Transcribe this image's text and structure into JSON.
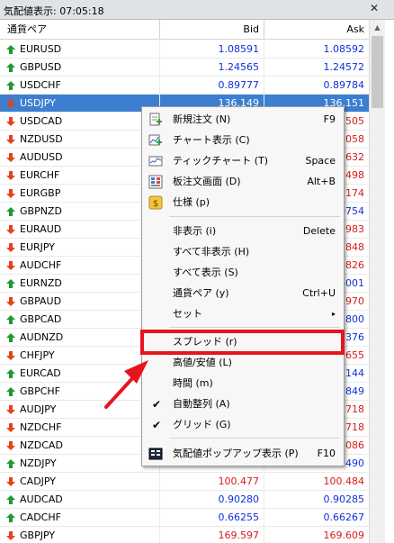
{
  "window": {
    "title": "気配値表示: 07:05:18",
    "close_glyph": "✕"
  },
  "columns": {
    "symbol": "通貨ペア",
    "bid": "Bid",
    "ask": "Ask"
  },
  "rows": [
    {
      "symbol": "EURUSD",
      "bid": "1.08591",
      "ask": "1.08592",
      "dir": "up"
    },
    {
      "symbol": "GBPUSD",
      "bid": "1.24565",
      "ask": "1.24572",
      "dir": "up"
    },
    {
      "symbol": "USDCHF",
      "bid": "0.89777",
      "ask": "0.89784",
      "dir": "up"
    },
    {
      "symbol": "USDJPY",
      "bid": "136.149",
      "ask": "136.151",
      "dir": "down",
      "selected": true
    },
    {
      "symbol": "USDCAD",
      "bid": "",
      "ask": "505",
      "dir": "down"
    },
    {
      "symbol": "NZDUSD",
      "bid": "",
      "ask": "2058",
      "dir": "down"
    },
    {
      "symbol": "AUDUSD",
      "bid": "",
      "ask": "5632",
      "dir": "down"
    },
    {
      "symbol": "EURCHF",
      "bid": "",
      "ask": "7498",
      "dir": "down"
    },
    {
      "symbol": "EURGBP",
      "bid": "",
      "ask": "7174",
      "dir": "down"
    },
    {
      "symbol": "GBPNZD",
      "bid": "",
      "ask": "0754",
      "dir": "up"
    },
    {
      "symbol": "EURAUD",
      "bid": "",
      "ask": "2983",
      "dir": "down"
    },
    {
      "symbol": "EURJPY",
      "bid": "",
      "ask": "848",
      "dir": "down"
    },
    {
      "symbol": "AUDCHF",
      "bid": "",
      "ask": "9826",
      "dir": "down"
    },
    {
      "symbol": "EURNZD",
      "bid": "",
      "ask": "6001",
      "dir": "up"
    },
    {
      "symbol": "GBPAUD",
      "bid": "",
      "ask": "5970",
      "dir": "down"
    },
    {
      "symbol": "GBPCAD",
      "bid": "",
      "ask": "3800",
      "dir": "up"
    },
    {
      "symbol": "AUDNZD",
      "bid": "",
      "ask": "7376",
      "dir": "up"
    },
    {
      "symbol": "CHFJPY",
      "bid": "",
      "ask": "655",
      "dir": "down"
    },
    {
      "symbol": "EURCAD",
      "bid": "",
      "ask": "7144",
      "dir": "up"
    },
    {
      "symbol": "GBPCHF",
      "bid": "",
      "ask": "1849",
      "dir": "up"
    },
    {
      "symbol": "AUDJPY",
      "bid": "",
      "ask": "718",
      "dir": "down"
    },
    {
      "symbol": "NZDCHF",
      "bid": "",
      "ask": "5718",
      "dir": "down"
    },
    {
      "symbol": "NZDCAD",
      "bid": "",
      "ask": "4086",
      "dir": "down"
    },
    {
      "symbol": "NZDJPY",
      "bid": "",
      "ask": "490",
      "dir": "up"
    },
    {
      "symbol": "CADJPY",
      "bid": "100.477",
      "ask": "100.484",
      "dir": "down"
    },
    {
      "symbol": "AUDCAD",
      "bid": "0.90280",
      "ask": "0.90285",
      "dir": "up"
    },
    {
      "symbol": "CADCHF",
      "bid": "0.66255",
      "ask": "0.66267",
      "dir": "up"
    },
    {
      "symbol": "GBPJPY",
      "bid": "169.597",
      "ask": "169.609",
      "dir": "down"
    }
  ],
  "menu": {
    "items": [
      {
        "label": "新規注文 (N)",
        "shortcut": "F9",
        "icon": "new-order-icon"
      },
      {
        "label": "チャート表示 (C)",
        "shortcut": "",
        "icon": "chart-window-icon"
      },
      {
        "label": "ティックチャート (T)",
        "shortcut": "Space",
        "icon": "tick-chart-icon"
      },
      {
        "label": "板注文画面 (D)",
        "shortcut": "Alt+B",
        "icon": "depth-of-market-icon"
      },
      {
        "label": "仕様 (p)",
        "shortcut": "",
        "icon": "specification-icon"
      },
      {
        "label": "非表示 (i)",
        "shortcut": "Delete"
      },
      {
        "label": "すべて非表示 (H)",
        "shortcut": ""
      },
      {
        "label": "すべて表示 (S)",
        "shortcut": ""
      },
      {
        "label": "通貨ペア (y)",
        "shortcut": "Ctrl+U"
      },
      {
        "label": "セット",
        "shortcut": "",
        "submenu": "▸"
      },
      {
        "label": "スプレッド (r)",
        "shortcut": ""
      },
      {
        "label": "高値/安値 (L)",
        "shortcut": ""
      },
      {
        "label": "時間 (m)",
        "shortcut": ""
      },
      {
        "label": "自動整列 (A)",
        "shortcut": "",
        "checked": "✔"
      },
      {
        "label": "グリッド (G)",
        "shortcut": "",
        "checked": "✔"
      },
      {
        "label": "気配値ポップアップ表示 (P)",
        "shortcut": "F10",
        "icon": "popup-prices-icon"
      }
    ]
  },
  "colors": {
    "up_arrow": "#1e9a2e",
    "down_arrow": "#e0451a",
    "bid_up": "#1030d8",
    "bid_down": "#d81a1a",
    "selected_row": "#3c7fd0",
    "highlight_box": "#e8141c"
  }
}
